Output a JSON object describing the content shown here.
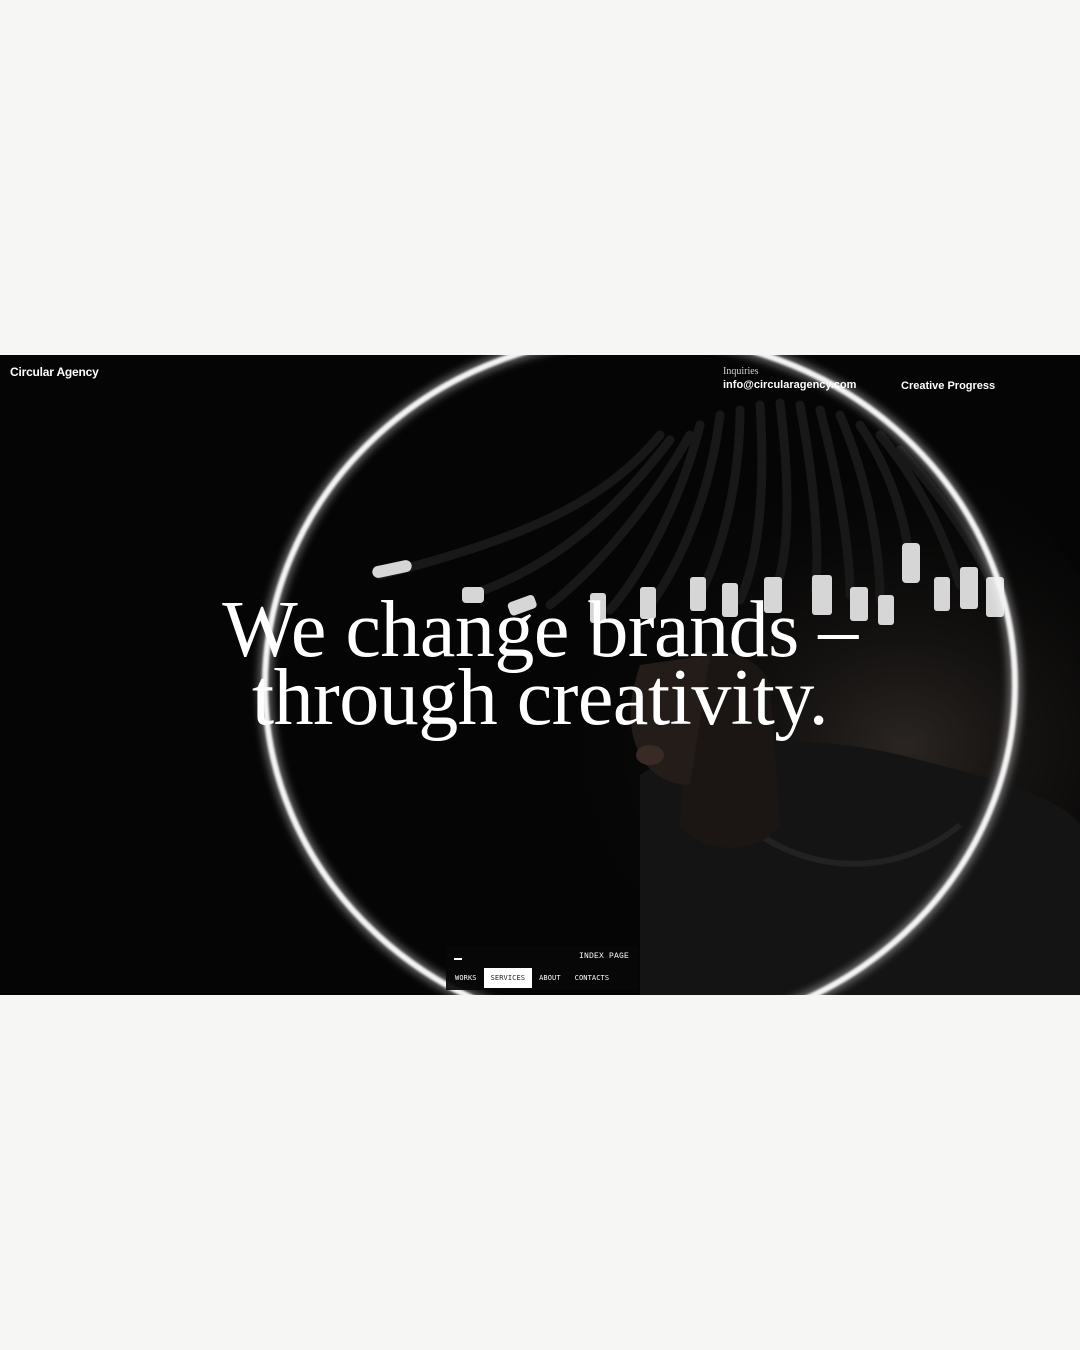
{
  "header": {
    "brand": "Circular Agency",
    "inquiries_label": "Inquiries",
    "inquiries_email": "info@circularagency.com",
    "tagline_link": "Creative Progress"
  },
  "hero": {
    "headline_line1": "We change brands –",
    "headline_line2": "through creativity.",
    "image_icon": "portrait-with-light-ring-image"
  },
  "nav": {
    "page_label": "INDEX PAGE",
    "items": [
      {
        "label": "WORKS",
        "active": false
      },
      {
        "label": "SERVICES",
        "active": true
      },
      {
        "label": "ABOUT",
        "active": false
      },
      {
        "label": "CONTACTS",
        "active": false
      }
    ]
  },
  "colors": {
    "page_background": "#f6f6f5",
    "hero_background": "#050505",
    "text": "#ffffff",
    "active_tab_bg": "#ffffff"
  }
}
